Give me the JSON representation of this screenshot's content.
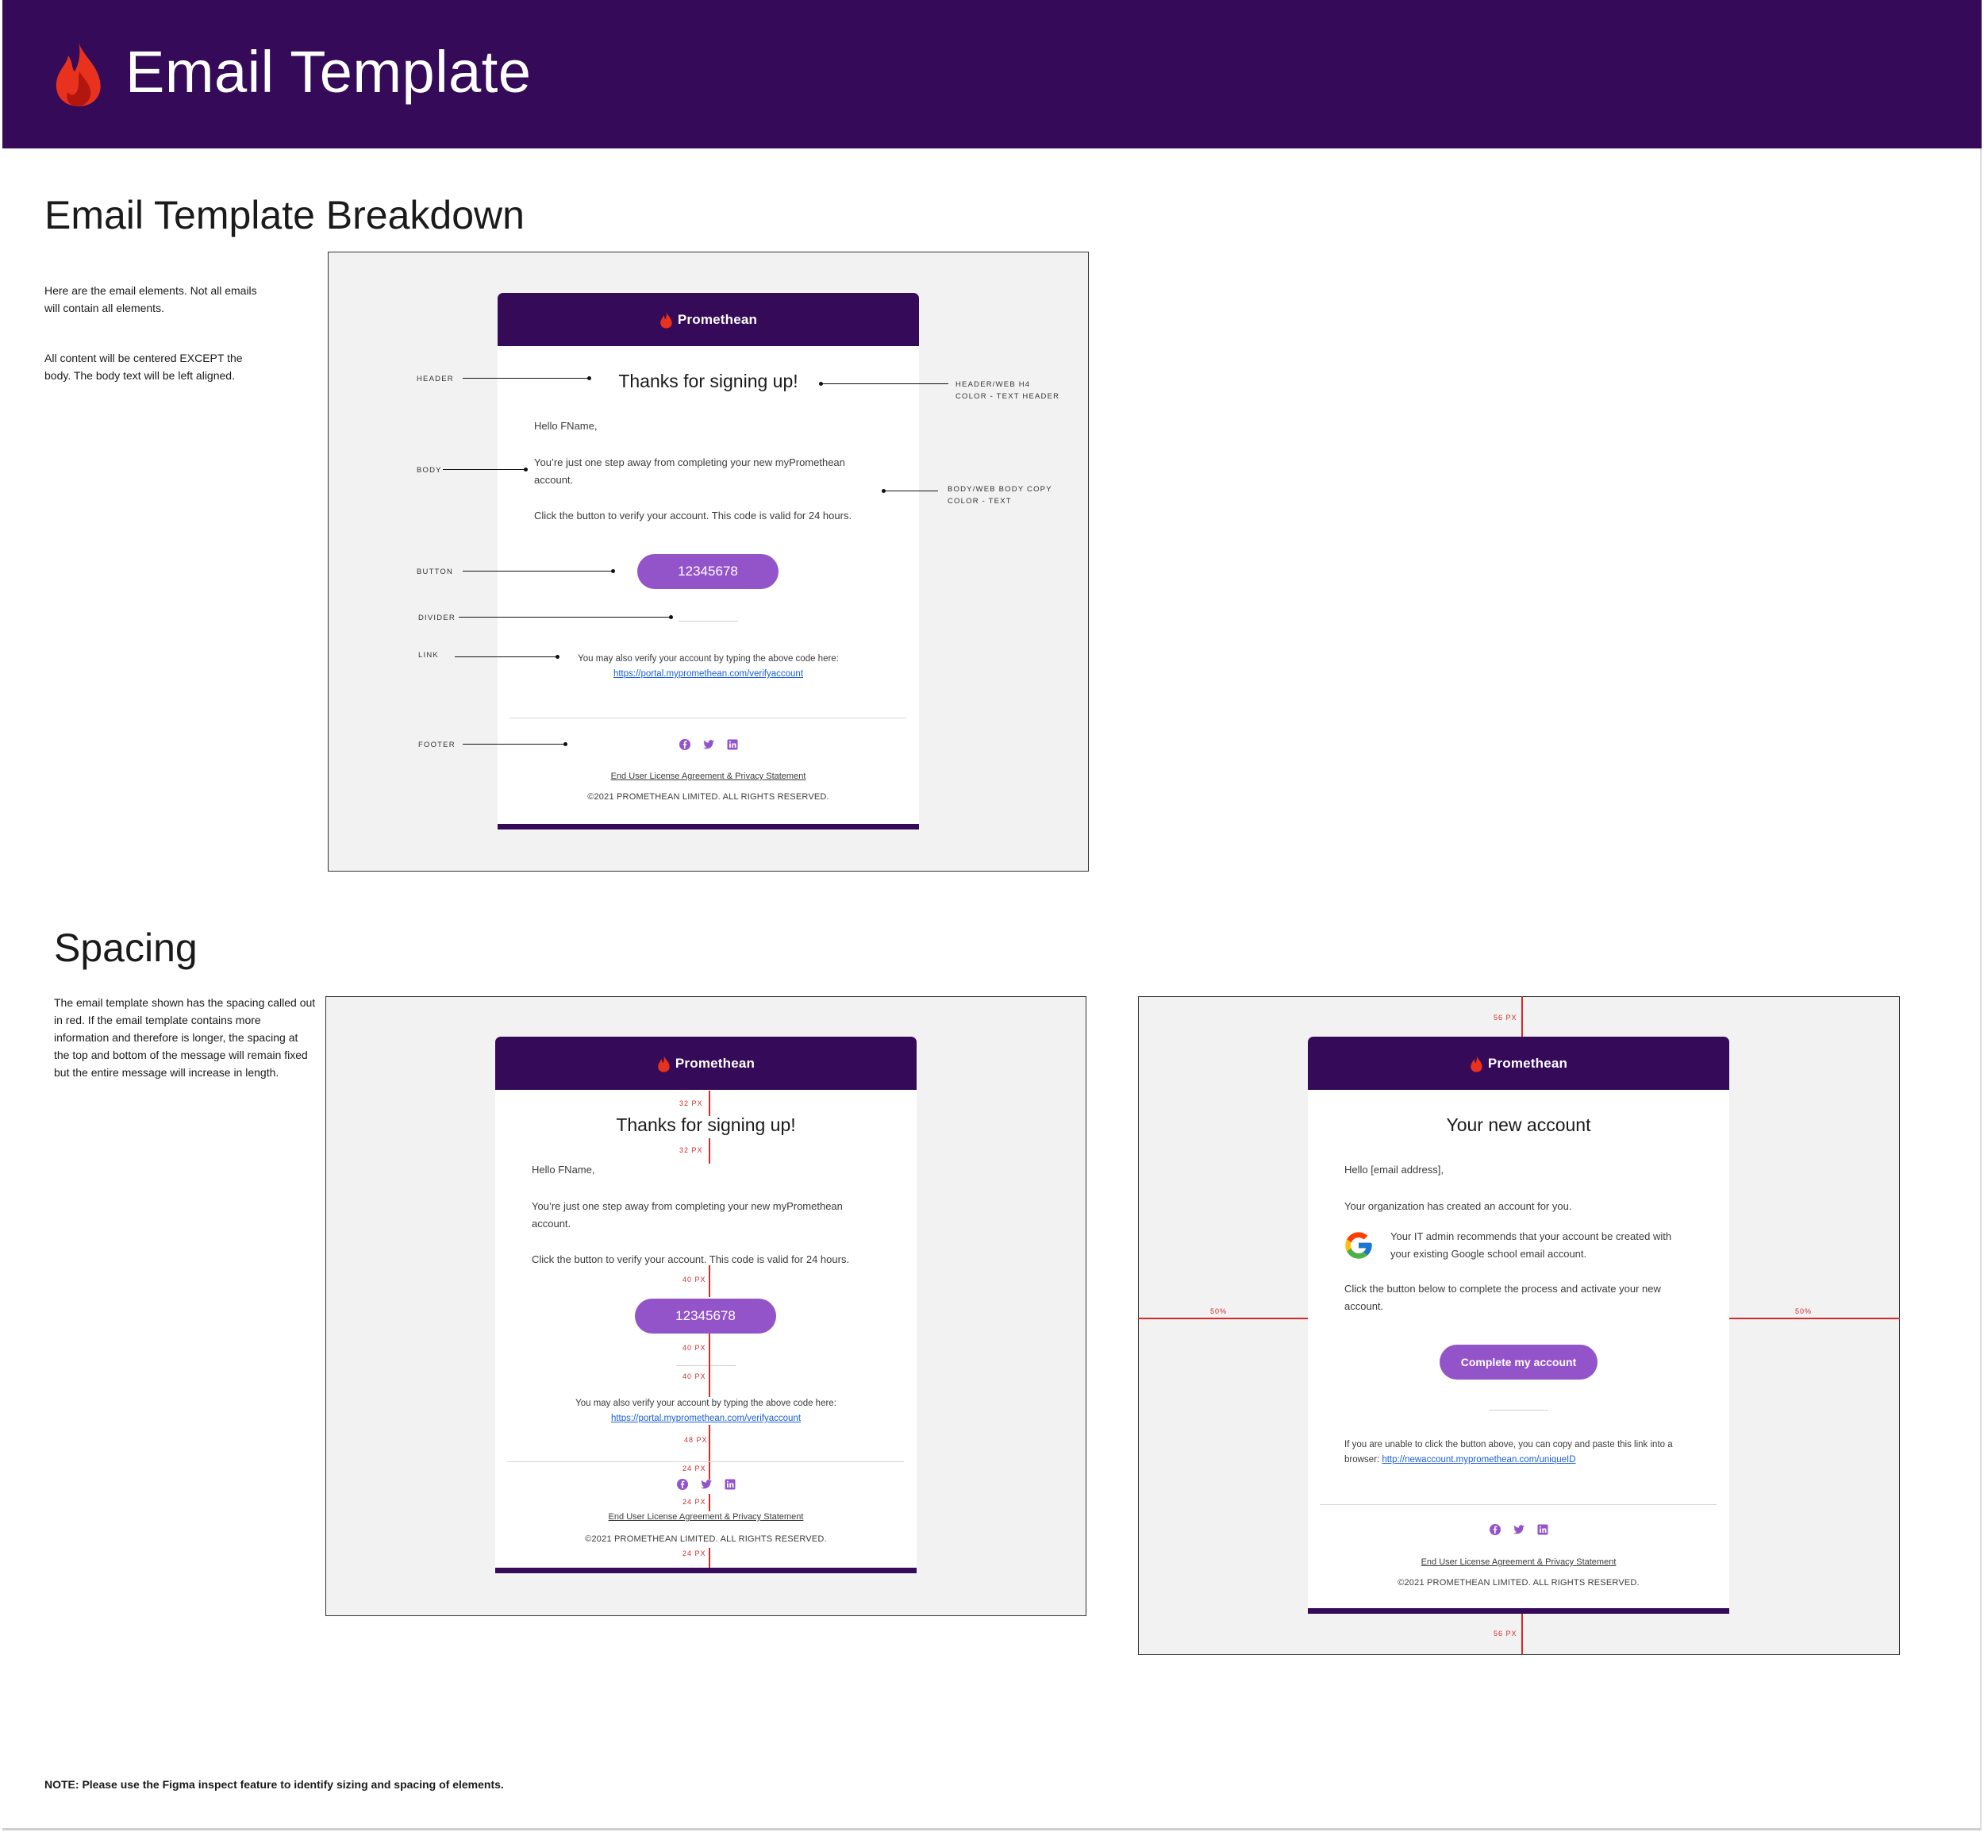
{
  "banner": {
    "title": "Email Template"
  },
  "breakdown": {
    "title": "Email Template Breakdown",
    "intro_1": "Here are the email elements. Not all emails will contain all elements.",
    "intro_2": "All content will be centered EXCEPT the body. The body text will be left aligned.",
    "callouts": {
      "header": "HEADER",
      "body": "BODY",
      "button": "BUTTON",
      "divider": "DIVIDER",
      "link": "LINK",
      "footer": "FOOTER",
      "header_spec_1": "HEADER/WEB H4",
      "header_spec_2": "COLOR - TEXT HEADER",
      "body_spec_1": "BODY/WEB BODY COPY",
      "body_spec_2": "COLOR - TEXT"
    }
  },
  "spacing": {
    "title": "Spacing",
    "intro": "The email template shown has the spacing called out in red. If the email template contains more information and therefore is longer, the spacing at the top and bottom of the message will remain fixed but the entire message will increase in length.",
    "labels": {
      "px32": "32 PX",
      "px40": "40 PX",
      "px48": "48 PX",
      "px24": "24 PX",
      "px56": "56 PX",
      "pct50": "50%"
    }
  },
  "email_signup": {
    "brand": "Promethean",
    "heading": "Thanks for signing up!",
    "greeting": "Hello FName,",
    "body_1": "You’re just one step away from completing your new myPromethean account.",
    "body_2": "Click the button to verify your account. This code is valid for 24 hours.",
    "button": "12345678",
    "link_intro": "You may also verify your account by typing the above code here:",
    "link": "https://portal.mypromethean.com/verifyaccount",
    "eula": "End User License Agreement & Privacy Statement",
    "copyright": "©2021 PROMETHEAN LIMITED. ALL RIGHTS RESERVED."
  },
  "email_account": {
    "brand": "Promethean",
    "heading": "Your new account",
    "greeting": "Hello [email address],",
    "body_1": "Your organization has created an account for you.",
    "google_text": "Your IT admin recommends that your account be created with your existing Google school email account.",
    "body_2": "Click the button below to complete the process and activate your new account.",
    "button": "Complete my account",
    "link_intro": "If you are unable to click the button above, you can copy and paste this link into a browser:",
    "link": "http://newaccount.mypromethean.com/uniqueID",
    "eula": "End User License Agreement & Privacy Statement",
    "copyright": "©2021 PROMETHEAN LIMITED. ALL RIGHTS RESERVED."
  },
  "note": "NOTE: Please use the Figma inspect feature to identify sizing and spacing of elements.",
  "colors": {
    "brand_purple": "#350a58",
    "button_purple": "#9454c9",
    "spacing_red": "#d12b2b",
    "flame_red": "#e8321e",
    "link_blue": "#1a5fd6"
  },
  "icons": [
    "flame-icon",
    "facebook-icon",
    "twitter-icon",
    "linkedin-icon",
    "google-icon"
  ]
}
